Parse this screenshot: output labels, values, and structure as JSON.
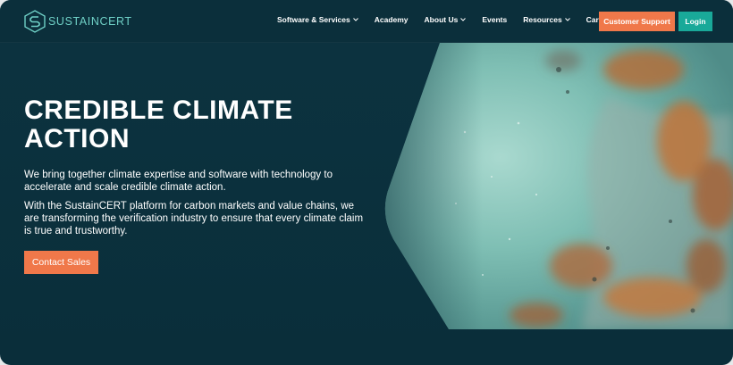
{
  "header": {
    "logo_text": "SUSTAINCERT",
    "nav": [
      {
        "label": "Software & Services",
        "has_dropdown": true
      },
      {
        "label": "Academy",
        "has_dropdown": false
      },
      {
        "label": "About Us",
        "has_dropdown": true
      },
      {
        "label": "Events",
        "has_dropdown": false
      },
      {
        "label": "Resources",
        "has_dropdown": true
      },
      {
        "label": "Careers",
        "has_dropdown": false
      }
    ],
    "support_label": "Customer Support",
    "login_label": "Login"
  },
  "hero": {
    "title": "CREDIBLE CLIMATE ACTION",
    "paragraph1": "We bring together climate expertise and software with technology to accelerate and scale credible climate action.",
    "paragraph2": "With the SustainCERT platform for carbon markets and value chains, we are transforming the verification industry to ensure that every climate claim is true and trustworthy.",
    "cta_label": "Contact Sales"
  },
  "colors": {
    "background": "#0b2f3b",
    "accent_orange": "#f0784a",
    "accent_teal": "#19a999",
    "logo_teal": "#6fd0c6"
  }
}
